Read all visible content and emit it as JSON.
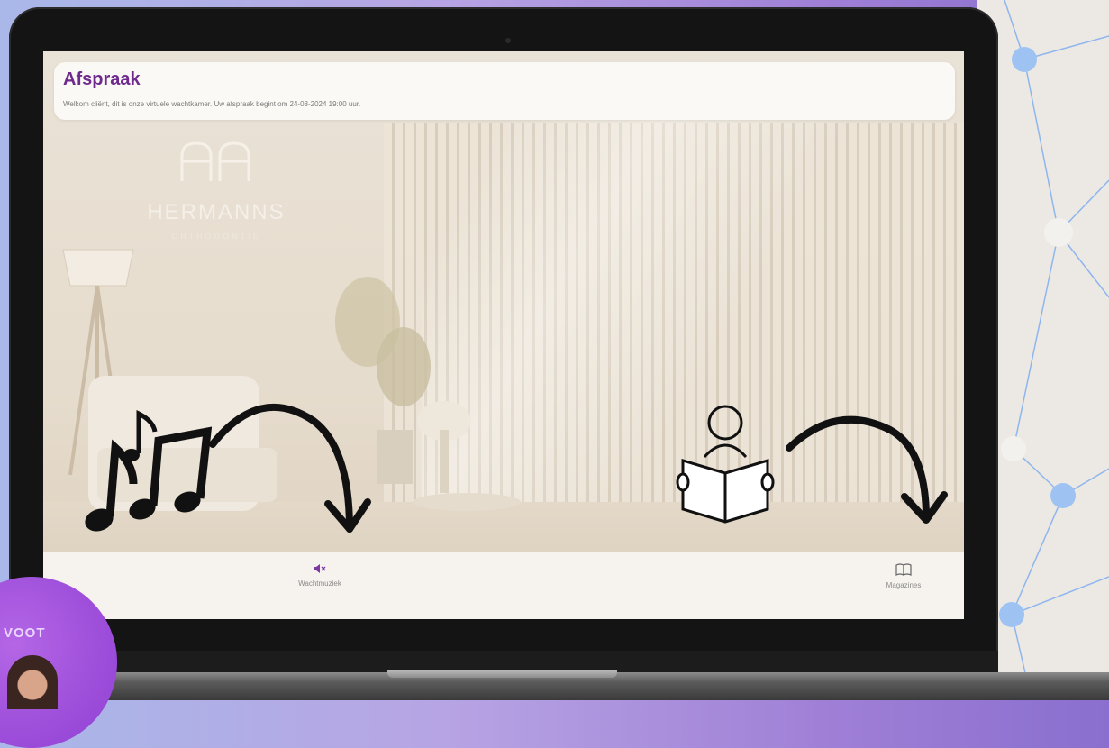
{
  "header": {
    "title": "Afspraak",
    "subtitle": "Welkom cliënt, dit is onze virtuele wachtkamer. Uw afspraak begint om 24-08-2024 19:00 uur."
  },
  "branding": {
    "name": "HERMANNS",
    "tagline": "ORTHODONTIE"
  },
  "bottom_bar": {
    "music_label": "Wachtmuziek",
    "music_icon": "speaker-muted-icon",
    "magazines_label": "Magazines",
    "magazines_icon": "book-open-icon"
  },
  "overlay": {
    "bubble_text": "VOOT"
  },
  "colors": {
    "title": "#6f2a8e",
    "accent": "#8f3fd2"
  }
}
